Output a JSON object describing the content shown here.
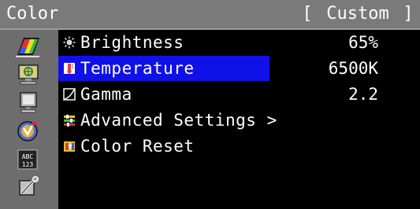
{
  "header": {
    "title": "Color",
    "mode_open": "[",
    "mode": "Custom",
    "mode_close": "]"
  },
  "sidebar": {
    "icons": [
      {
        "name": "color-icon",
        "selected": true
      },
      {
        "name": "screen-icon"
      },
      {
        "name": "monitor-icon"
      },
      {
        "name": "power-icon"
      },
      {
        "name": "language-icon"
      },
      {
        "name": "tools-icon"
      }
    ]
  },
  "menu": {
    "items": [
      {
        "label": "Brightness",
        "value": "65%",
        "icon": "brightness-icon"
      },
      {
        "label": "Temperature",
        "value": "6500K",
        "icon": "temperature-icon",
        "active": true
      },
      {
        "label": "Gamma",
        "value": "2.2",
        "icon": "gamma-icon"
      },
      {
        "label": "Advanced Settings >",
        "value": "",
        "icon": "advanced-settings-icon"
      },
      {
        "label": "Color Reset",
        "value": "",
        "icon": "color-reset-icon"
      }
    ]
  },
  "colors": {
    "highlight": "#1010e8",
    "titlebar": "#7a7a7a",
    "sidebar": "#6d6d6d",
    "background": "#000000"
  }
}
